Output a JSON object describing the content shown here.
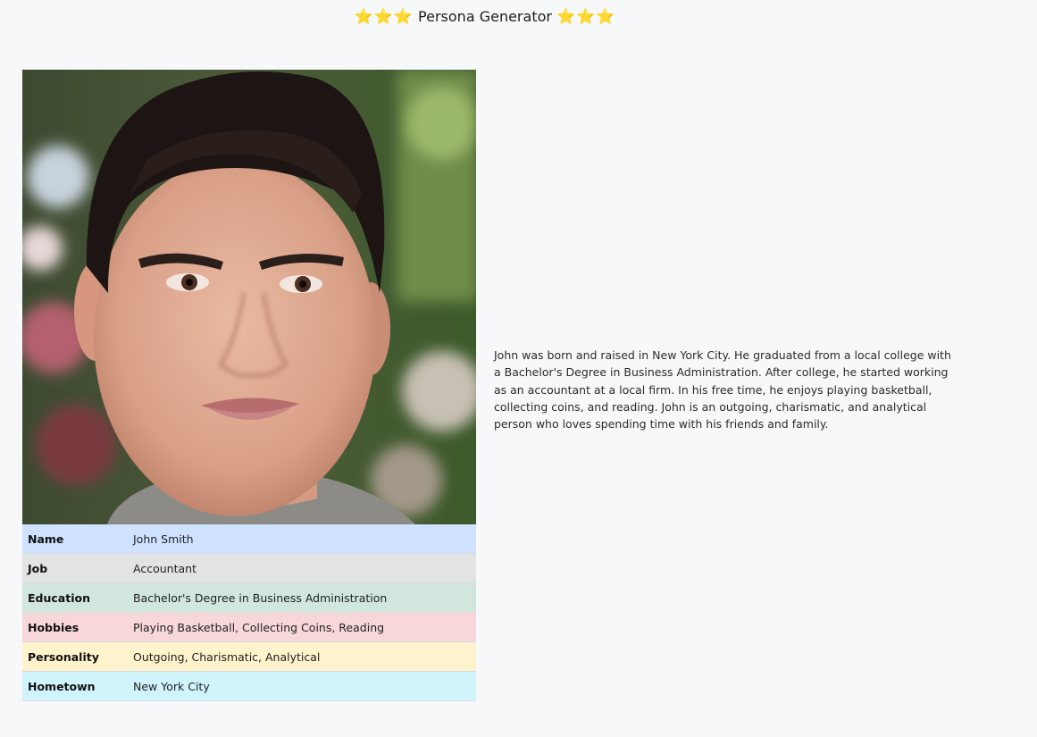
{
  "header": {
    "stars_left": "⭐⭐⭐",
    "title": "Persona Generator",
    "stars_right": "⭐⭐⭐"
  },
  "persona": {
    "photo_icon": "portrait-photo",
    "attributes": [
      {
        "key": "Name",
        "value": "John Smith",
        "color": "#cfe2ff"
      },
      {
        "key": "Job",
        "value": "Accountant",
        "color": "#e2e3e5"
      },
      {
        "key": "Education",
        "value": "Bachelor's Degree in Business Administration",
        "color": "#d1e7dd"
      },
      {
        "key": "Hobbies",
        "value": "Playing Basketball, Collecting Coins, Reading",
        "color": "#f8d7da"
      },
      {
        "key": "Personality",
        "value": "Outgoing, Charismatic, Analytical",
        "color": "#fff3cd"
      },
      {
        "key": "Hometown",
        "value": "New York City",
        "color": "#cff4fc"
      }
    ],
    "bio": "John was born and raised in New York City. He graduated from a local college with a Bachelor's Degree in Business Administration. After college, he started working as an accountant at a local firm. In his free time, he enjoys playing basketball, collecting coins, and reading. John is an outgoing, charismatic, and analytical person who loves spending time with his friends and family."
  }
}
